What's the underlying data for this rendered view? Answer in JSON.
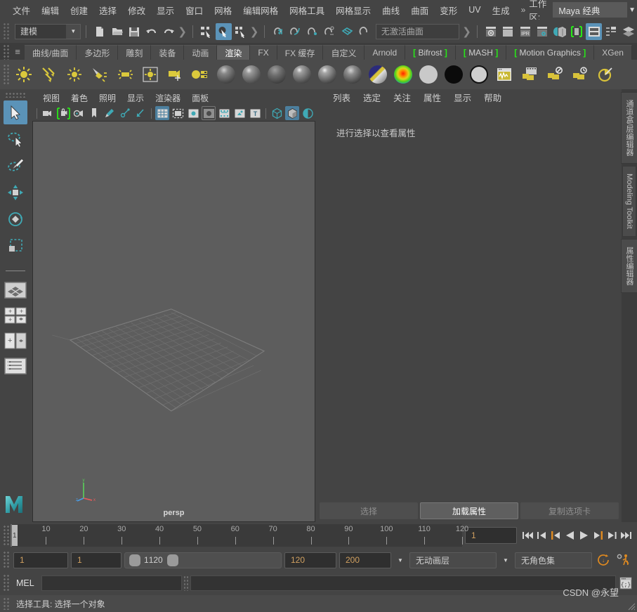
{
  "menubar": {
    "items": [
      "文件",
      "编辑",
      "创建",
      "选择",
      "修改",
      "显示",
      "窗口",
      "网格",
      "编辑网格",
      "网格工具",
      "网格显示",
      "曲线",
      "曲面",
      "变形",
      "UV",
      "生成"
    ],
    "overflow": "»",
    "workspace_label": "工作区:",
    "workspace_value": "Maya 经典"
  },
  "statusline": {
    "mode": "建模",
    "surface_field": "无激活曲面",
    "icons": [
      "new-scene-icon",
      "open-scene-icon",
      "save-scene-icon",
      "undo-icon",
      "redo-icon",
      "select-hierarchy-icon",
      "select-object-icon",
      "select-component-icon",
      "snap-grid-icon",
      "snap-curve-icon",
      "snap-point-icon",
      "snap-projected-icon",
      "snap-view-plane-icon",
      "make-live-icon",
      "render-view-icon",
      "render-current-frame-icon",
      "ipr-render-icon",
      "render-settings-icon",
      "hypershade-icon",
      "render-setup-icon",
      "display-editor-icon",
      "outliner-icon",
      "node-editor-icon",
      "layer-editor-icon"
    ]
  },
  "shelf": {
    "tabs": [
      {
        "label": "曲线/曲面",
        "active": false
      },
      {
        "label": "多边形",
        "active": false
      },
      {
        "label": "雕刻",
        "active": false
      },
      {
        "label": "装备",
        "active": false
      },
      {
        "label": "动画",
        "active": false
      },
      {
        "label": "渲染",
        "active": true
      },
      {
        "label": "FX",
        "active": false
      },
      {
        "label": "FX 缓存",
        "active": false
      },
      {
        "label": "自定义",
        "active": false
      },
      {
        "label": "Arnold",
        "active": false
      },
      {
        "label": "Bifrost",
        "active": false,
        "bracket": true
      },
      {
        "label": "MASH",
        "active": false,
        "bracket": true
      },
      {
        "label": "Motion Graphics",
        "active": false,
        "bracket": true
      },
      {
        "label": "XGen",
        "active": false
      }
    ],
    "icons": [
      "ambient-light-icon",
      "directional-light-icon",
      "point-light-icon",
      "spot-light-icon",
      "area-light-icon",
      "volume-light-icon",
      "create-camera-icon",
      "light-editor-icon",
      "blinn-material-icon",
      "lambert-material-icon",
      "phong-material-icon",
      "anisotropic-material-icon",
      "phongE-material-icon",
      "blinn2-material-icon",
      "layered-shader-icon",
      "ramp-shader-icon",
      "surface-shader-icon",
      "use-background-icon",
      "shading-map-icon",
      "hypershade-window-icon",
      "render-view-window-icon",
      "render-sequence-icon",
      "batch-render-icon",
      "render-settings-window-icon"
    ]
  },
  "toolbox": {
    "items": [
      {
        "name": "select-tool",
        "selected": true
      },
      {
        "name": "lasso-select-tool",
        "selected": false
      },
      {
        "name": "paint-select-tool",
        "selected": false
      },
      {
        "name": "move-tool",
        "selected": false
      },
      {
        "name": "rotate-tool",
        "selected": false
      },
      {
        "name": "scale-tool",
        "selected": false
      }
    ],
    "layouts": [
      "single-perspective-layout",
      "four-view-layout",
      "two-pane-layout",
      "outliner-persp-layout"
    ]
  },
  "viewport": {
    "panel_menus": [
      "视图",
      "着色",
      "照明",
      "显示",
      "渲染器",
      "面板"
    ],
    "camera_label": "persp",
    "toolbar_icons": [
      "select-camera-icon",
      "lock-camera-icon",
      "camera-attributes-icon",
      "bookmark-icon",
      "image-plane-icon",
      "twopoint-resolution-icon",
      "exposure-icon",
      "grid-toggle-icon",
      "film-gate-icon",
      "resolution-gate-icon",
      "gate-mask-icon",
      "xray-joints-icon",
      "xray-active-icon",
      "texture-toggle-icon",
      "wireframe-shading-icon",
      "smooth-shading-icon",
      "shadow-toggle-icon"
    ]
  },
  "attribute_editor": {
    "menus": [
      "列表",
      "选定",
      "关注",
      "属性",
      "显示",
      "帮助"
    ],
    "empty_message": "进行选择以查看属性",
    "buttons": [
      {
        "label": "选择",
        "primary": false
      },
      {
        "label": "加载属性",
        "primary": true
      },
      {
        "label": "复制选项卡",
        "primary": false
      }
    ]
  },
  "right_tabs": [
    {
      "label": "通道盒/层编辑器"
    },
    {
      "label": "Modeling Toolkit"
    },
    {
      "label": "属性编辑器"
    }
  ],
  "time_slider": {
    "ticks": [
      10,
      20,
      30,
      40,
      50,
      60,
      70,
      80,
      90,
      100,
      110,
      120
    ],
    "start": 1,
    "end": 120,
    "current_frame": "1",
    "playhead_label": "1",
    "transport_icons": [
      "go-to-start-icon",
      "step-back-keyframe-icon",
      "step-back-frame-icon",
      "play-backwards-icon",
      "play-forwards-icon",
      "step-forward-frame-icon",
      "step-forward-keyframe-icon",
      "go-to-end-icon"
    ]
  },
  "range_slider": {
    "anim_start": "1",
    "range_start": "1",
    "range_min_label": "1",
    "range_max_label": "120",
    "range_end": "120",
    "anim_end": "200",
    "anim_layer": "无动画层",
    "character_set": "无角色集",
    "auto_key_icon": "auto-keyframe-icon",
    "anim_prefs_icon": "animation-preferences-icon"
  },
  "command_line": {
    "language": "MEL",
    "input_value": "",
    "output_value": "",
    "script_editor_icon": "script-editor-icon"
  },
  "help_line": {
    "text": "选择工具: 选择一个对象",
    "watermark": "CSDN @永望"
  },
  "colors": {
    "app_bg": "#444444",
    "panel_bg": "#4b4b4b",
    "viewport_bg": "#5d5d5d",
    "accent_blue": "#5b93b8",
    "accent_teal": "#3fa9b5",
    "accent_orange": "#d0a060",
    "bracket_green": "#27e817",
    "shelf_yellow": "#d8c23a"
  }
}
